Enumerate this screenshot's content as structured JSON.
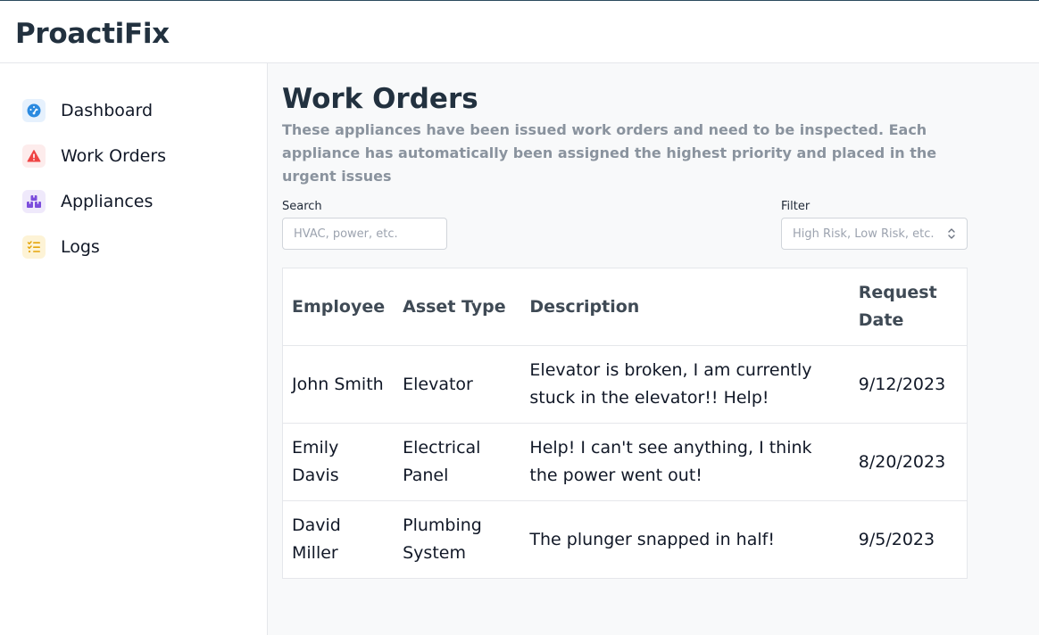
{
  "app": {
    "title": "ProactiFix"
  },
  "sidebar": {
    "items": [
      {
        "label": "Dashboard",
        "icon": "gauge-icon",
        "color": "#2b8ae0",
        "bg": "#e6f1fd"
      },
      {
        "label": "Work Orders",
        "icon": "warning-icon",
        "color": "#ef4444",
        "bg": "#fdecec"
      },
      {
        "label": "Appliances",
        "icon": "boxes-icon",
        "color": "#7c4ddc",
        "bg": "#efe9fb"
      },
      {
        "label": "Logs",
        "icon": "checklist-icon",
        "color": "#e5a50a",
        "bg": "#fdf3d6"
      }
    ]
  },
  "main": {
    "title": "Work Orders",
    "description": "These appliances have been issued work orders and need to be inspected. Each appliance has automatically been assigned the highest priority and placed in the urgent issues",
    "search": {
      "label": "Search",
      "placeholder": "HVAC, power, etc."
    },
    "filter": {
      "label": "Filter",
      "placeholder": "High Risk, Low Risk, etc."
    },
    "table": {
      "headers": [
        "Employee",
        "Asset Type",
        "Description",
        "Request Date"
      ],
      "rows": [
        [
          "John Smith",
          "Elevator",
          "Elevator is broken, I am currently stuck in the elevator!! Help!",
          "9/12/2023"
        ],
        [
          "Emily Davis",
          "Electrical Panel",
          "Help! I can't see anything, I think the power went out!",
          "8/20/2023"
        ],
        [
          "David Miller",
          "Plumbing System",
          "The plunger snapped in half!",
          "9/5/2023"
        ]
      ]
    }
  }
}
